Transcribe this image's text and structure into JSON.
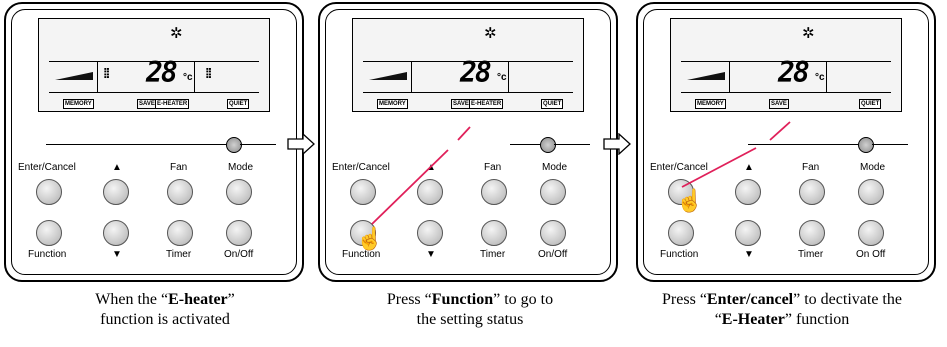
{
  "panels": [
    {
      "lcd": {
        "sun": "✲",
        "temp": "28",
        "unit": "°c",
        "tags": [
          "MEMORY",
          "SAVE",
          "E-HEATER",
          "QUIET"
        ]
      },
      "labels": {
        "enter": "Enter/Cancel",
        "up": "▲",
        "fan": "Fan",
        "mode": "Mode",
        "function": "Function",
        "down": "▼",
        "timer": "Timer",
        "onoff": "On/Off"
      },
      "caption": {
        "pre": "When the “",
        "bold": "E-heater",
        "post": "”",
        "line2": "function is activated"
      }
    },
    {
      "lcd": {
        "sun": "✲",
        "temp": "28",
        "unit": "°c",
        "tags": [
          "MEMORY",
          "SAVE",
          "E-HEATER",
          "QUIET"
        ]
      },
      "labels": {
        "enter": "Enter/Cancel",
        "up": "▲",
        "fan": "Fan",
        "mode": "Mode",
        "function": "Function",
        "down": "▼",
        "timer": "Timer",
        "onoff": "On/Off"
      },
      "caption": {
        "pre": "Press “",
        "bold": "Function",
        "post": "” to go to",
        "line2": "the setting status"
      }
    },
    {
      "lcd": {
        "sun": "✲",
        "temp": "28",
        "unit": "°c",
        "tags": [
          "MEMORY",
          "SAVE",
          "QUIET"
        ]
      },
      "labels": {
        "enter": "Enter/Cancel",
        "up": "▲",
        "fan": "Fan",
        "mode": "Mode",
        "function": "Function",
        "down": "▼",
        "timer": "Timer",
        "onoff": "On Off"
      },
      "caption": {
        "pre": "Press “",
        "bold": "Enter/cancel",
        "post": "” to dectivate the",
        "line2pre": "“",
        "line2bold": "E-Heater",
        "line2post": "” function"
      }
    }
  ],
  "colors": {
    "highlight_line": "#e0205a",
    "arrow": "#000000"
  }
}
